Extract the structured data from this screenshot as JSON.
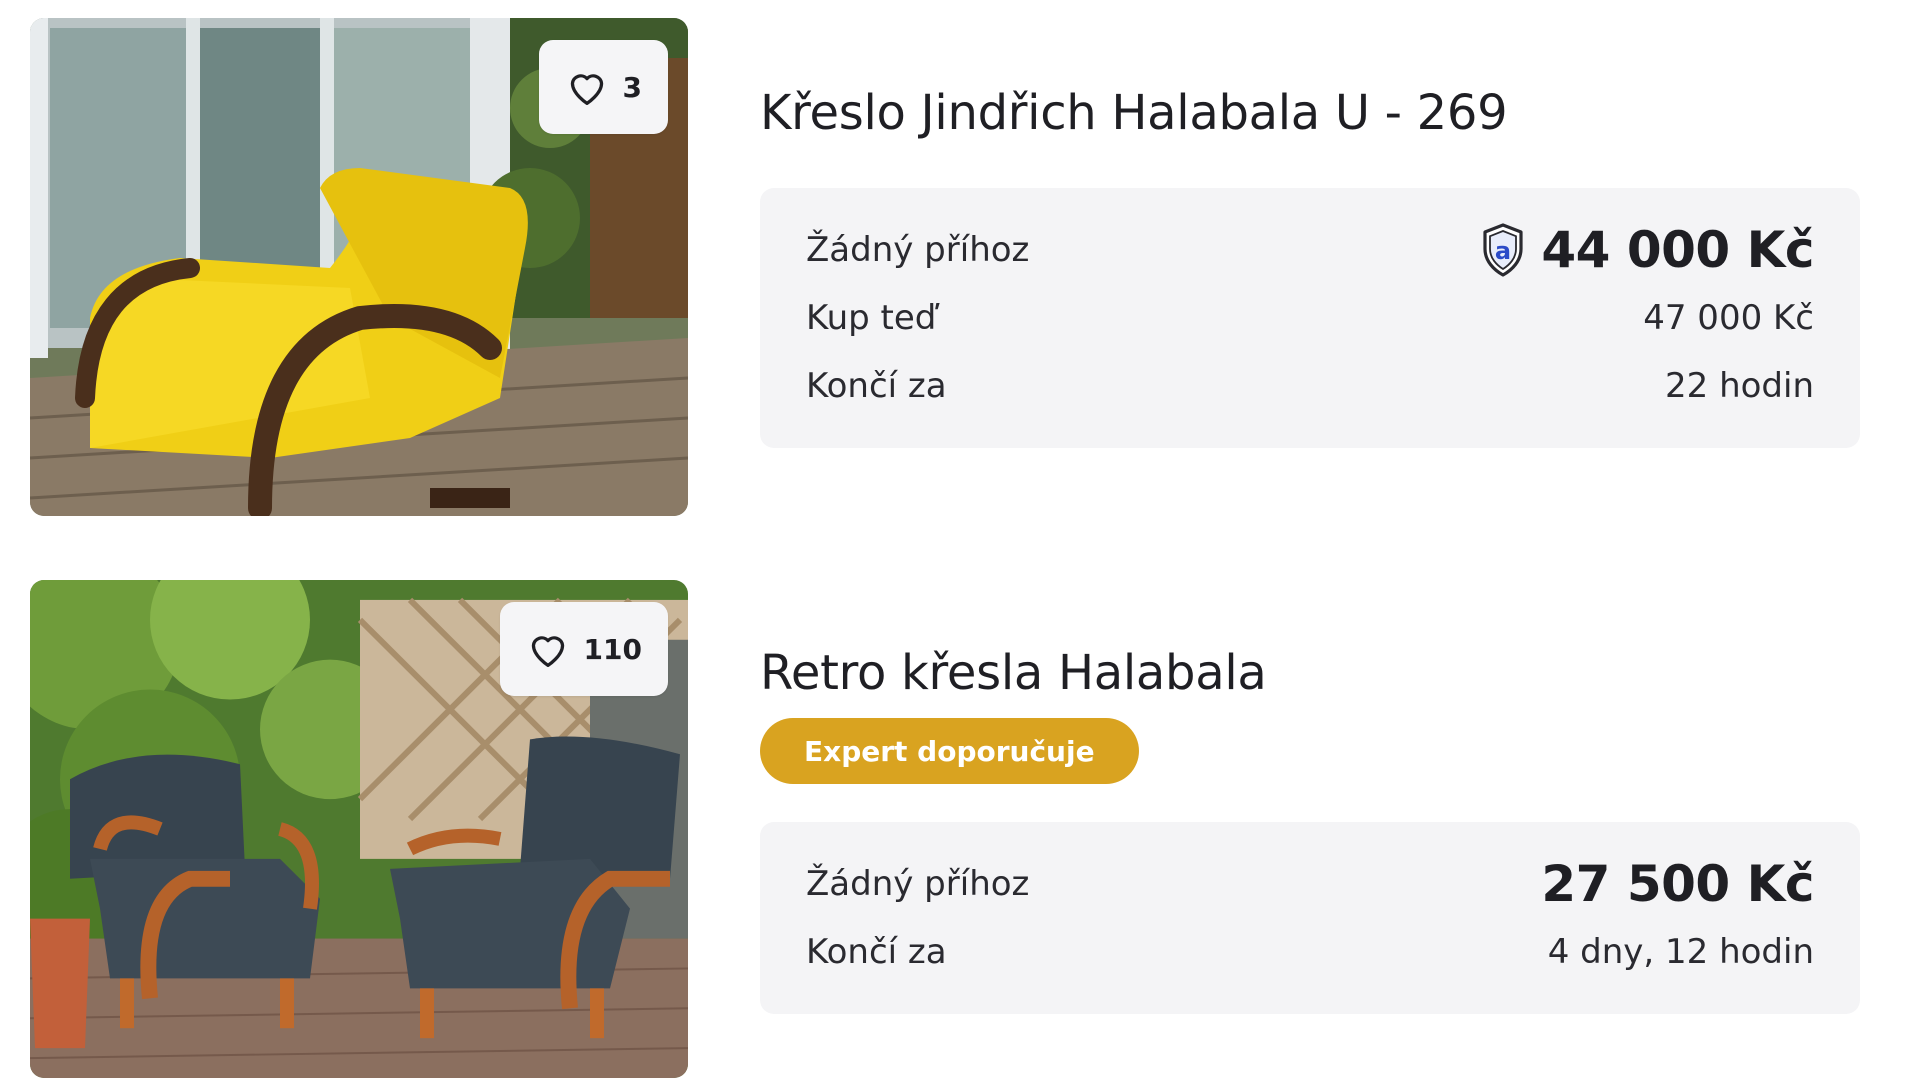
{
  "listings": [
    {
      "title": "Křeslo Jindřich Halabala U - 269",
      "favorites": "3",
      "favorite_icon": "heart-outline-icon",
      "price_icon": "aukro-shield-icon",
      "rows": [
        {
          "label": "Žádný příhoz",
          "value": "44 000 Kč"
        },
        {
          "label": "Kup teď",
          "value": "47 000 Kč"
        },
        {
          "label": "Končí za",
          "value": "22 hodin"
        }
      ]
    },
    {
      "title": "Retro křesla Halabala",
      "favorites": "110",
      "favorite_icon": "heart-outline-icon",
      "badge": "Expert doporučuje",
      "rows": [
        {
          "label": "Žádný příhoz",
          "value": "27 500 Kč"
        },
        {
          "label": "Končí za",
          "value": "4 dny, 12 hodin"
        }
      ]
    }
  ],
  "colors": {
    "badge_bg": "#d9a320",
    "panel_bg": "#f4f4f6",
    "shield_blue": "#2b4bc8"
  }
}
